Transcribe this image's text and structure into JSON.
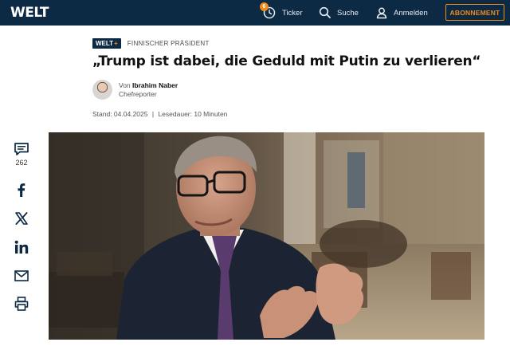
{
  "header": {
    "logo": "WELT",
    "ticker_badge": "6",
    "ticker_label": "Ticker",
    "search_label": "Suche",
    "login_label": "Anmelden",
    "subscribe_label": "ABONNEMENT"
  },
  "article": {
    "plus_badge": "WELT",
    "plus_sign": "+",
    "kicker": "FINNISCHER PRÄSIDENT",
    "headline": "„Trump ist dabei, die Geduld mit Putin zu verlieren“",
    "author_prefix": "Von",
    "author_name": "Ibrahim Naber",
    "author_role": "Chefreporter",
    "date_label": "Stand: 04.04.2025",
    "separator": "|",
    "reading_time": "Lesedauer: 10 Minuten"
  },
  "share_rail": {
    "comment_count": "262",
    "items": [
      "comments-icon",
      "facebook-icon",
      "x-icon",
      "linkedin-icon",
      "mail-icon",
      "print-icon"
    ]
  },
  "colors": {
    "header_bg": "#0d2a44",
    "accent": "#f08a1c"
  }
}
